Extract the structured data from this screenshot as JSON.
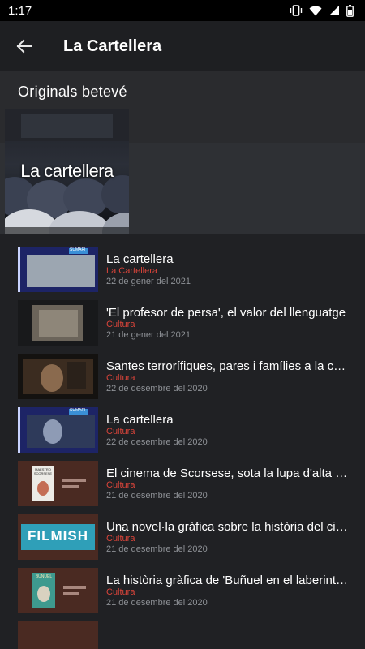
{
  "status": {
    "time": "1:17"
  },
  "appbar": {
    "title": "La Cartellera",
    "back_icon": "arrow-left-icon"
  },
  "section": {
    "title": "Originals betevé"
  },
  "hero": {
    "label": "La cartellera"
  },
  "colors": {
    "category": "#d9443a",
    "date": "#8e9196",
    "background": "#202124"
  },
  "items": [
    {
      "title": "La cartellera",
      "category": "La Cartellera",
      "date": "22 de gener del 2021",
      "thumb_text": "SUMARI",
      "thumb": "sumari"
    },
    {
      "title": "'El profesor de persa', el valor del llenguatge",
      "category": "Cultura",
      "date": "21 de gener del 2021",
      "thumb_text": "",
      "thumb": "paper"
    },
    {
      "title": "Santes terrorífiques, pares i famílies a la cartellera",
      "category": "Cultura",
      "date": "22 de desembre del 2020",
      "thumb_text": "",
      "thumb": "film"
    },
    {
      "title": "La cartellera",
      "category": "Cultura",
      "date": "22 de desembre del 2020",
      "thumb_text": "SUMARI",
      "thumb": "sumari2"
    },
    {
      "title": "El cinema de Scorsese, sota la lupa d'alta definició",
      "category": "Cultura",
      "date": "21 de desembre del 2020",
      "thumb_text": "MAESTRO SCORSESE",
      "thumb": "book"
    },
    {
      "title": "Una novel·la gràfica sobre la història del cinema",
      "category": "Cultura",
      "date": "21 de desembre del 2020",
      "thumb_text": "FILMISH",
      "thumb": "filmish"
    },
    {
      "title": "La història gràfica de  'Buñuel en el laberint de les tortugues'",
      "category": "Cultura",
      "date": "21 de desembre del 2020",
      "thumb_text": "BUÑUEL",
      "thumb": "bunuel"
    }
  ]
}
